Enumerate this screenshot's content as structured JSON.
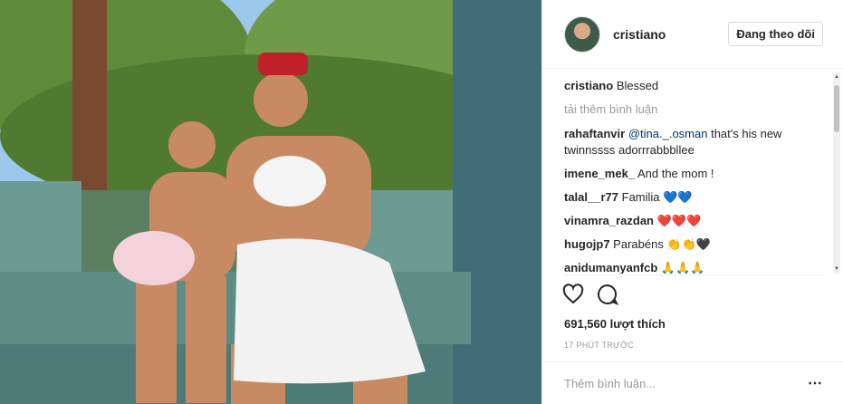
{
  "post": {
    "username": "cristiano",
    "follow_label": "Đang theo dõi"
  },
  "caption": {
    "user": "cristiano",
    "text": "Blessed"
  },
  "load_more": "tải thêm bình luận",
  "comments": [
    {
      "user": "rahaftanvir",
      "mention": "@tina._.osman",
      "text": " that's his new twinnssss adorrrabbbllee"
    },
    {
      "user": "imene_mek_",
      "text": "And the mom !"
    },
    {
      "user": "talal__r77",
      "text": "Familia 💙💙"
    },
    {
      "user": "vinamra_razdan",
      "text": "❤️❤️❤️"
    },
    {
      "user": "hugojp7",
      "text": "Parabéns 👏👏🖤"
    },
    {
      "user": "anidumanyanfcb",
      "text": "🙏🙏🙏"
    }
  ],
  "likes": "691,560 lượt thích",
  "time": "17 PHÚT TRƯỚC",
  "add_comment_placeholder": "Thêm bình luận...",
  "more_icon": "⋯",
  "icons": [
    "heart-icon",
    "comment-icon",
    "more-options-icon",
    "scroll-up-icon",
    "scroll-down-icon"
  ],
  "colors": {
    "mention": "#003569",
    "muted": "#999999",
    "heart_blue": "#3aa0e0",
    "heart_red": "#e0245e"
  }
}
